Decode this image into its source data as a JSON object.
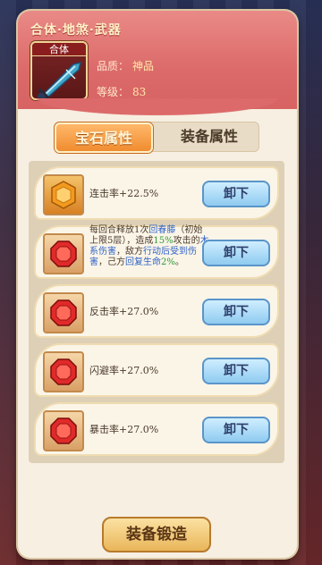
{
  "header": {
    "title": "合体·地煞·武器",
    "icon_tag": "合体",
    "quality_label": "品质：",
    "quality_value": "神品",
    "level_label": "等级：",
    "level_value": "83"
  },
  "tabs": [
    {
      "label": "宝石属性",
      "active": true
    },
    {
      "label": "装备属性",
      "active": false
    }
  ],
  "gems": [
    {
      "gem_color": "orange",
      "text": "连击率+22.5%",
      "button": "卸下"
    },
    {
      "gem_color": "red",
      "text_parts": [
        "每回合释放1次",
        "回春藤",
        "（初始上限5层），造成",
        "15%",
        "攻击的",
        "木系伤害",
        "，敌方",
        "行动后受到伤害",
        "，己方",
        "回复生命",
        "2%",
        "。"
      ],
      "button": "卸下"
    },
    {
      "gem_color": "red",
      "text": "反击率+27.0%",
      "button": "卸下"
    },
    {
      "gem_color": "red",
      "text": "闪避率+27.0%",
      "button": "卸下"
    },
    {
      "gem_color": "red",
      "text": "暴击率+27.0%",
      "button": "卸下"
    }
  ],
  "footer": {
    "forge_button": "装备锻造"
  },
  "colors": {
    "accent_red": "#dc6a6a",
    "tab_active": "#f08c2f",
    "button_blue": "#8fcbf0",
    "text_blue": "#2f64c8",
    "text_green": "#2f9a3a"
  }
}
